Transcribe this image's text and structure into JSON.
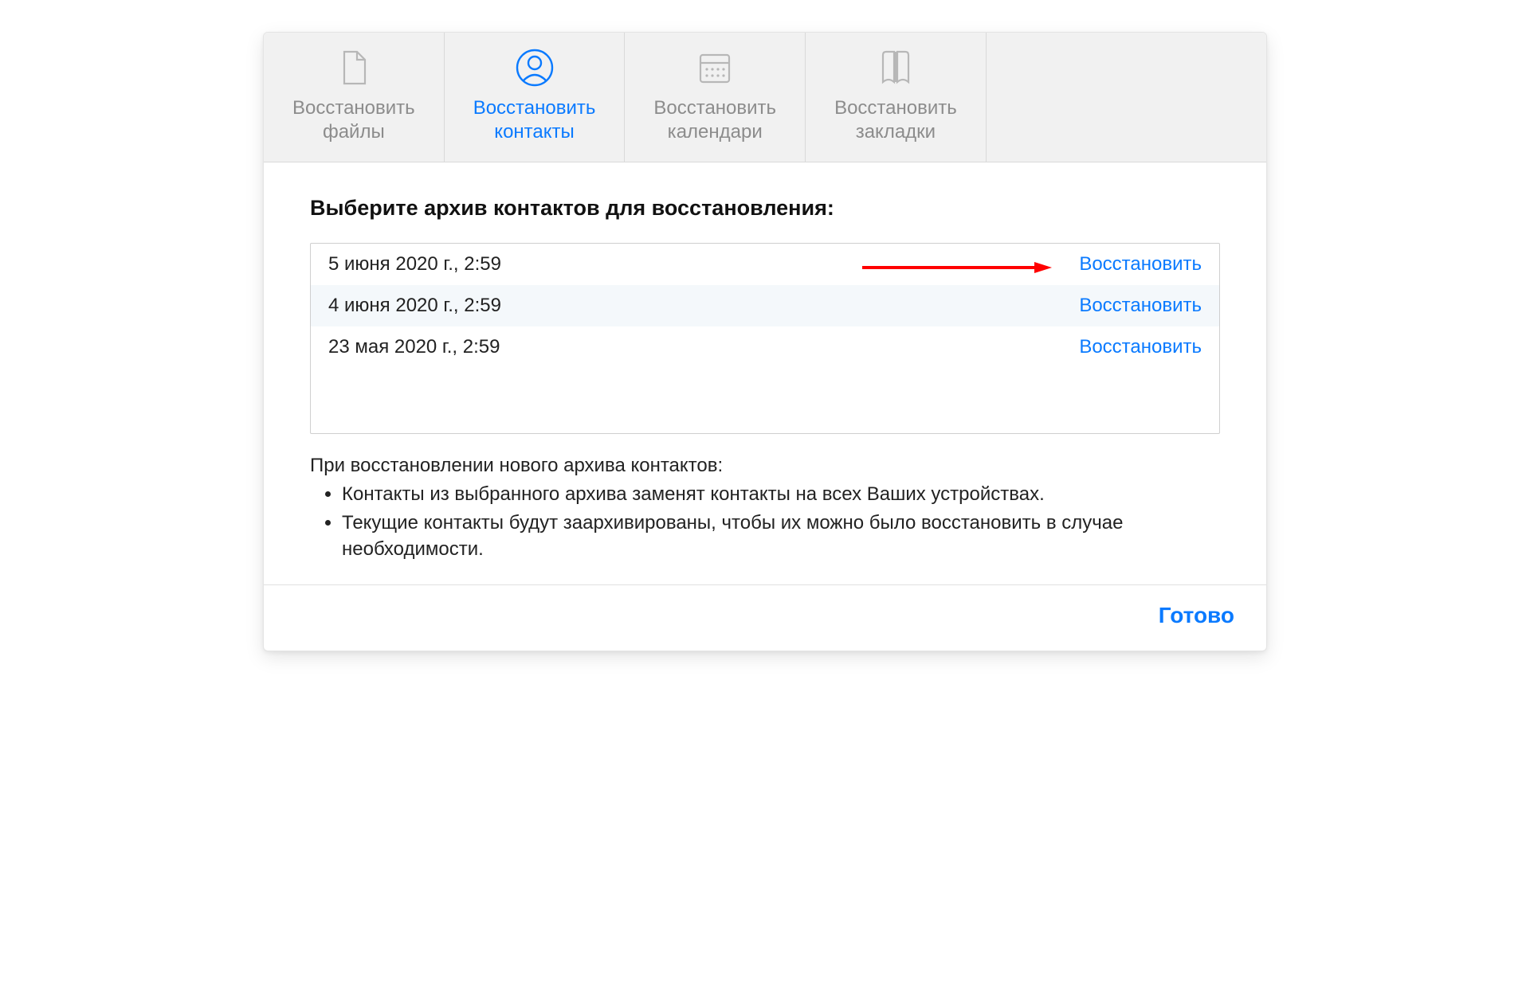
{
  "colors": {
    "accent": "#0a7aff",
    "muted": "#8c8c8c"
  },
  "tabs": [
    {
      "id": "files",
      "label_line1": "Восстановить",
      "label_line2": "файлы",
      "active": false
    },
    {
      "id": "contacts",
      "label_line1": "Восстановить",
      "label_line2": "контакты",
      "active": true
    },
    {
      "id": "calendars",
      "label_line1": "Восстановить",
      "label_line2": "календари",
      "active": false
    },
    {
      "id": "bookmarks",
      "label_line1": "Восстановить",
      "label_line2": "закладки",
      "active": false
    }
  ],
  "heading": "Выберите архив контактов для восстановления:",
  "archives": [
    {
      "date": "5 июня 2020 г., 2:59",
      "action": "Восстановить"
    },
    {
      "date": "4 июня 2020 г., 2:59",
      "action": "Восстановить"
    },
    {
      "date": "23 мая 2020 г., 2:59",
      "action": "Восстановить"
    }
  ],
  "notes_title": "При восстановлении нового архива контактов:",
  "notes": [
    "Контакты из выбранного архива заменят контакты на всех Ваших устройствах.",
    "Текущие контакты будут заархивированы, чтобы их можно было восстановить в случае необходимости."
  ],
  "done_label": "Готово"
}
